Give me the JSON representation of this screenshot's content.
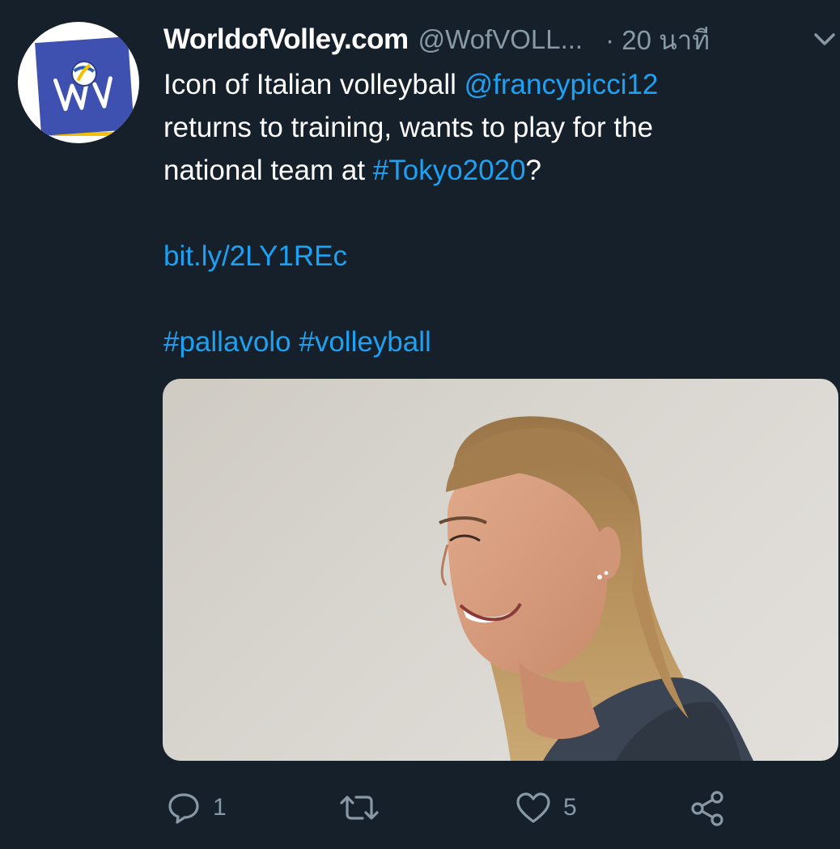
{
  "tweet": {
    "author": {
      "display_name": "WorldofVolley.com",
      "handle": "@WofVOLL...",
      "avatar_icon": "wov-logo-icon"
    },
    "time": "· 20 นาที",
    "menu_icon": "chevron-down-icon",
    "text": {
      "line1_prefix": "Icon of Italian volleyball ",
      "mention": "@francypicci12",
      "line2": "returns to training, wants to play for the",
      "line3_prefix": "national team at ",
      "hashtag_tokyo": "#Tokyo2020",
      "line3_suffix": "?",
      "url": "bit.ly/2LY1REc",
      "hashtag_pallavolo": "#pallavolo",
      "hashtag_volleyball": "#volleyball"
    },
    "media": {
      "description_icon": "photo-icon"
    },
    "actions": {
      "reply_count": "1",
      "retweet_count": "",
      "like_count": "5"
    }
  },
  "colors": {
    "background": "#15202b",
    "link": "#1da1f2",
    "secondary_text": "#8899a6",
    "primary_text": "#ffffff"
  }
}
